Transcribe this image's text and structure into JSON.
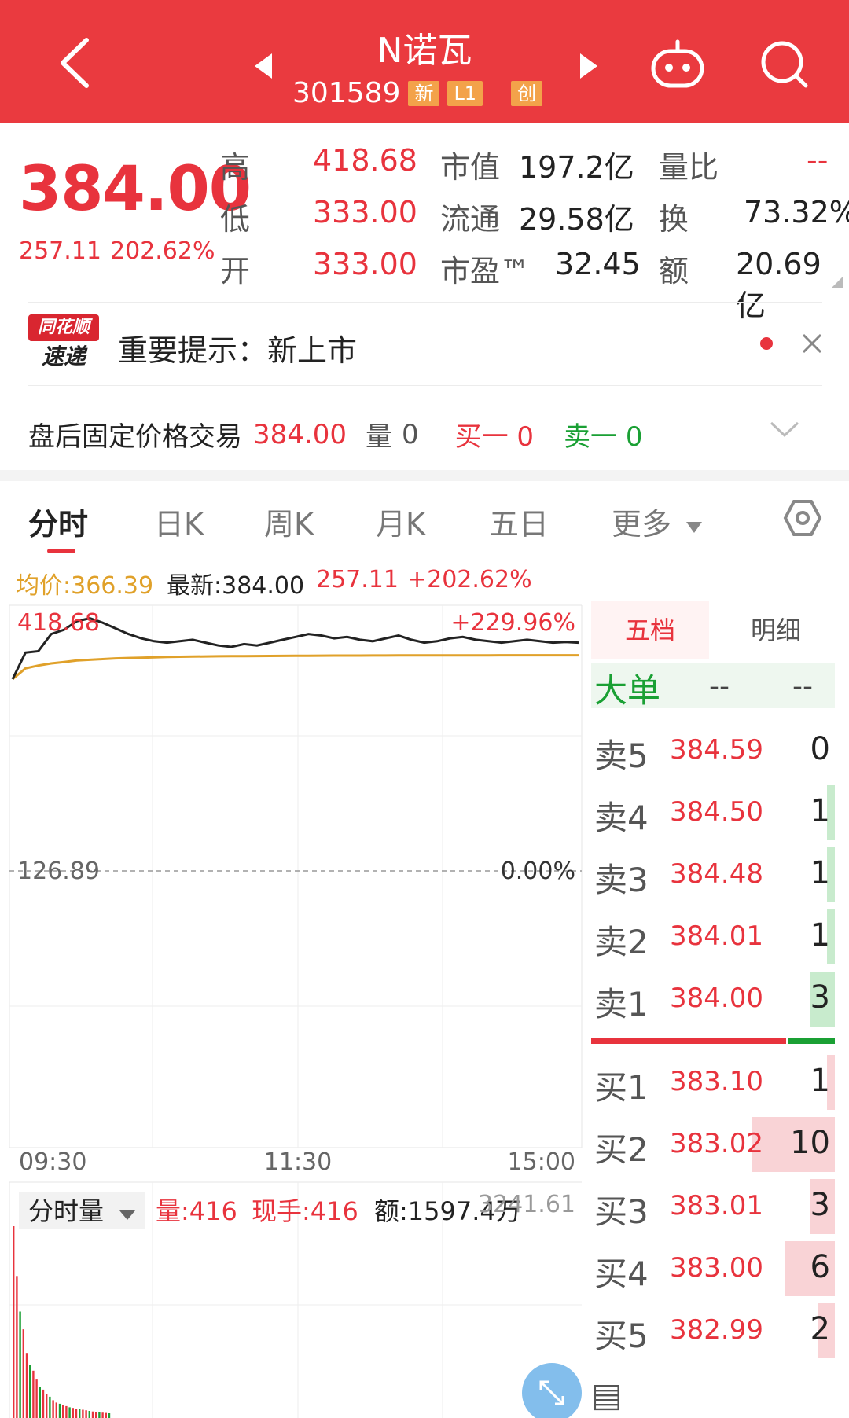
{
  "header": {
    "title": "N诺瓦",
    "code": "301589",
    "tags": [
      "新",
      "L1",
      "创"
    ]
  },
  "quote": {
    "price": "384.00",
    "change": "257.11",
    "change_pct": "202.62%",
    "rows": [
      {
        "l1": "高",
        "v1": "418.68",
        "l2": "市值",
        "v2": "197.2亿",
        "l3": "量比",
        "v3": "--"
      },
      {
        "l1": "低",
        "v1": "333.00",
        "l2": "流通",
        "v2": "29.58亿",
        "l3": "换",
        "v3": "73.32%"
      },
      {
        "l1": "开",
        "v1": "333.00",
        "l2": "市盈™",
        "v2": "32.45",
        "l3": "额",
        "v3": "20.69亿"
      }
    ]
  },
  "notice": {
    "logo_top": "同花顺",
    "logo_bottom": "速递",
    "text": "重要提示：新上市"
  },
  "after_hours": {
    "label": "盘后固定价格交易",
    "price": "384.00",
    "vol_label": "量",
    "vol": "0",
    "buy1": "买一 0",
    "sell1": "卖一 0"
  },
  "tabs": [
    "分时",
    "日K",
    "周K",
    "月K",
    "五日",
    "更多"
  ],
  "info_line": {
    "avg": "均价:366.39",
    "latest": "最新:384.00",
    "change": "257.11",
    "change_pct": "+202.62%"
  },
  "chart_data": {
    "type": "line",
    "price_high": "418.68",
    "pct_high": "+229.96%",
    "price_base": "126.89",
    "pct_base": "0.00%",
    "x_ticks": [
      "09:30",
      "11:30",
      "15:00"
    ],
    "volume": {
      "selector": "分时量",
      "vol": "量:416",
      "cur": "现手:416",
      "amt": "额:1597.4万",
      "max": "3241.61"
    },
    "series": [
      {
        "name": "最新",
        "color": "#222222",
        "values": [
          333,
          370,
          372,
          396,
          402,
          414,
          418,
          412,
          404,
          396,
          390,
          386,
          384,
          386,
          388,
          384,
          380,
          378,
          382,
          380,
          384,
          388,
          392,
          396,
          394,
          390,
          392,
          388,
          386,
          390,
          394,
          388,
          384,
          386,
          390,
          392,
          388,
          386,
          384,
          386,
          388,
          386,
          384,
          385,
          384
        ]
      },
      {
        "name": "均价",
        "color": "#e0a12a",
        "values": [
          333,
          348,
          352,
          355,
          357,
          359,
          360,
          361,
          362,
          362.5,
          363,
          363.5,
          364,
          364.3,
          364.5,
          364.8,
          365,
          365.1,
          365.2,
          365.3,
          365.4,
          365.5,
          365.6,
          365.7,
          365.8,
          365.9,
          366,
          366,
          366.1,
          366.1,
          366.2,
          366.2,
          366.2,
          366.3,
          366.3,
          366.3,
          366.3,
          366.3,
          366.4,
          366.4,
          366.4,
          366.4,
          366.4,
          366.4,
          366.39
        ]
      }
    ],
    "volume_values": [
      3241,
      2400,
      1800,
      1500,
      1100,
      900,
      800,
      650,
      520,
      480,
      400,
      360,
      300,
      260,
      240,
      220,
      200,
      180,
      170,
      160,
      150,
      140,
      130,
      120,
      110,
      100,
      95,
      90,
      85,
      80
    ]
  },
  "order_book": {
    "tabs": [
      "五档",
      "明细"
    ],
    "big_order": {
      "label": "大单",
      "a": "--",
      "b": "--"
    },
    "sell": [
      {
        "label": "卖5",
        "price": "384.59",
        "vol": "0",
        "bar": 0
      },
      {
        "label": "卖4",
        "price": "384.50",
        "vol": "1",
        "bar": 0.1
      },
      {
        "label": "卖3",
        "price": "384.48",
        "vol": "1",
        "bar": 0.1
      },
      {
        "label": "卖2",
        "price": "384.01",
        "vol": "1",
        "bar": 0.1
      },
      {
        "label": "卖1",
        "price": "384.00",
        "vol": "3",
        "bar": 0.3
      }
    ],
    "buy": [
      {
        "label": "买1",
        "price": "383.10",
        "vol": "1",
        "bar": 0.1
      },
      {
        "label": "买2",
        "price": "383.02",
        "vol": "10",
        "bar": 1.0
      },
      {
        "label": "买3",
        "price": "383.01",
        "vol": "3",
        "bar": 0.3
      },
      {
        "label": "买4",
        "price": "383.00",
        "vol": "6",
        "bar": 0.6
      },
      {
        "label": "买5",
        "price": "382.99",
        "vol": "2",
        "bar": 0.2
      }
    ],
    "split_ratio": 0.8,
    "colors": {
      "sell_bar": "#c8ebcd",
      "buy_bar": "#f9d3d6",
      "red": "#e8333d",
      "green": "#1aa034"
    }
  }
}
